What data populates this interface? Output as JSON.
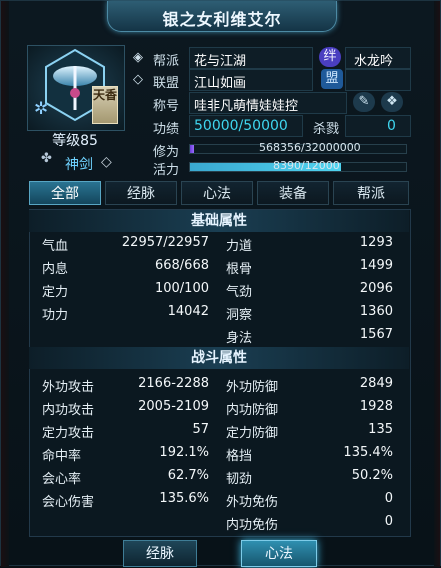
{
  "window": {
    "title": "银之女利维艾尔"
  },
  "character": {
    "level": "等级85",
    "badge": "天香",
    "weapon": "神剑",
    "weapon_icon_label": "神剑"
  },
  "info": {
    "guild_label": "帮派",
    "guild": "花与江湖",
    "guild_badge": "绊",
    "guild_title": "水龙吟",
    "alliance_label": "联盟",
    "alliance": "江山如画",
    "alliance_badge": "盟",
    "nick_label": "称号",
    "nick": "哇非凡萌情娃娃控",
    "merit_label": "功绩",
    "merit": "50000/50000",
    "kill_label": "杀戮",
    "kill": "0",
    "cultivation_label": "修为",
    "cultivation": "568356/32000000",
    "cultivation_fill": 0.018,
    "vitality_label": "活力",
    "vitality": "8390/12000",
    "vitality_fill": 0.699
  },
  "tabs": [
    "全部",
    "经脉",
    "心法",
    "装备",
    "帮派"
  ],
  "active_tab": 0,
  "basic": {
    "title": "基础属性",
    "left": [
      {
        "name": "气血",
        "value": "22957/22957"
      },
      {
        "name": "内息",
        "value": "668/668"
      },
      {
        "name": "定力",
        "value": "100/100"
      },
      {
        "name": "功力",
        "value": "14042"
      }
    ],
    "right": [
      {
        "name": "力道",
        "value": "1293"
      },
      {
        "name": "根骨",
        "value": "1499"
      },
      {
        "name": "气劲",
        "value": "2096"
      },
      {
        "name": "洞察",
        "value": "1360"
      },
      {
        "name": "身法",
        "value": "1567"
      }
    ]
  },
  "combat": {
    "title": "战斗属性",
    "left": [
      {
        "name": "外功攻击",
        "value": "2166-2288"
      },
      {
        "name": "内功攻击",
        "value": "2005-2109"
      },
      {
        "name": "定力攻击",
        "value": "57"
      },
      {
        "name": "命中率",
        "value": "192.1%"
      },
      {
        "name": "会心率",
        "value": "62.7%"
      },
      {
        "name": "会心伤害",
        "value": "135.6%"
      }
    ],
    "right": [
      {
        "name": "外功防御",
        "value": "2849"
      },
      {
        "name": "内功防御",
        "value": "1928"
      },
      {
        "name": "定力防御",
        "value": "135"
      },
      {
        "name": "格挡",
        "value": "135.4%"
      },
      {
        "name": "韧劲",
        "value": "50.2%"
      },
      {
        "name": "外功免伤",
        "value": "0"
      },
      {
        "name": "内功免伤",
        "value": "0"
      }
    ]
  },
  "buttons": {
    "meridian": "经脉",
    "method": "心法"
  },
  "colors": {
    "accent": "#3fd6ef",
    "bar_purple": "#9a6cff",
    "bar_cyan": "#4fd3ef"
  }
}
